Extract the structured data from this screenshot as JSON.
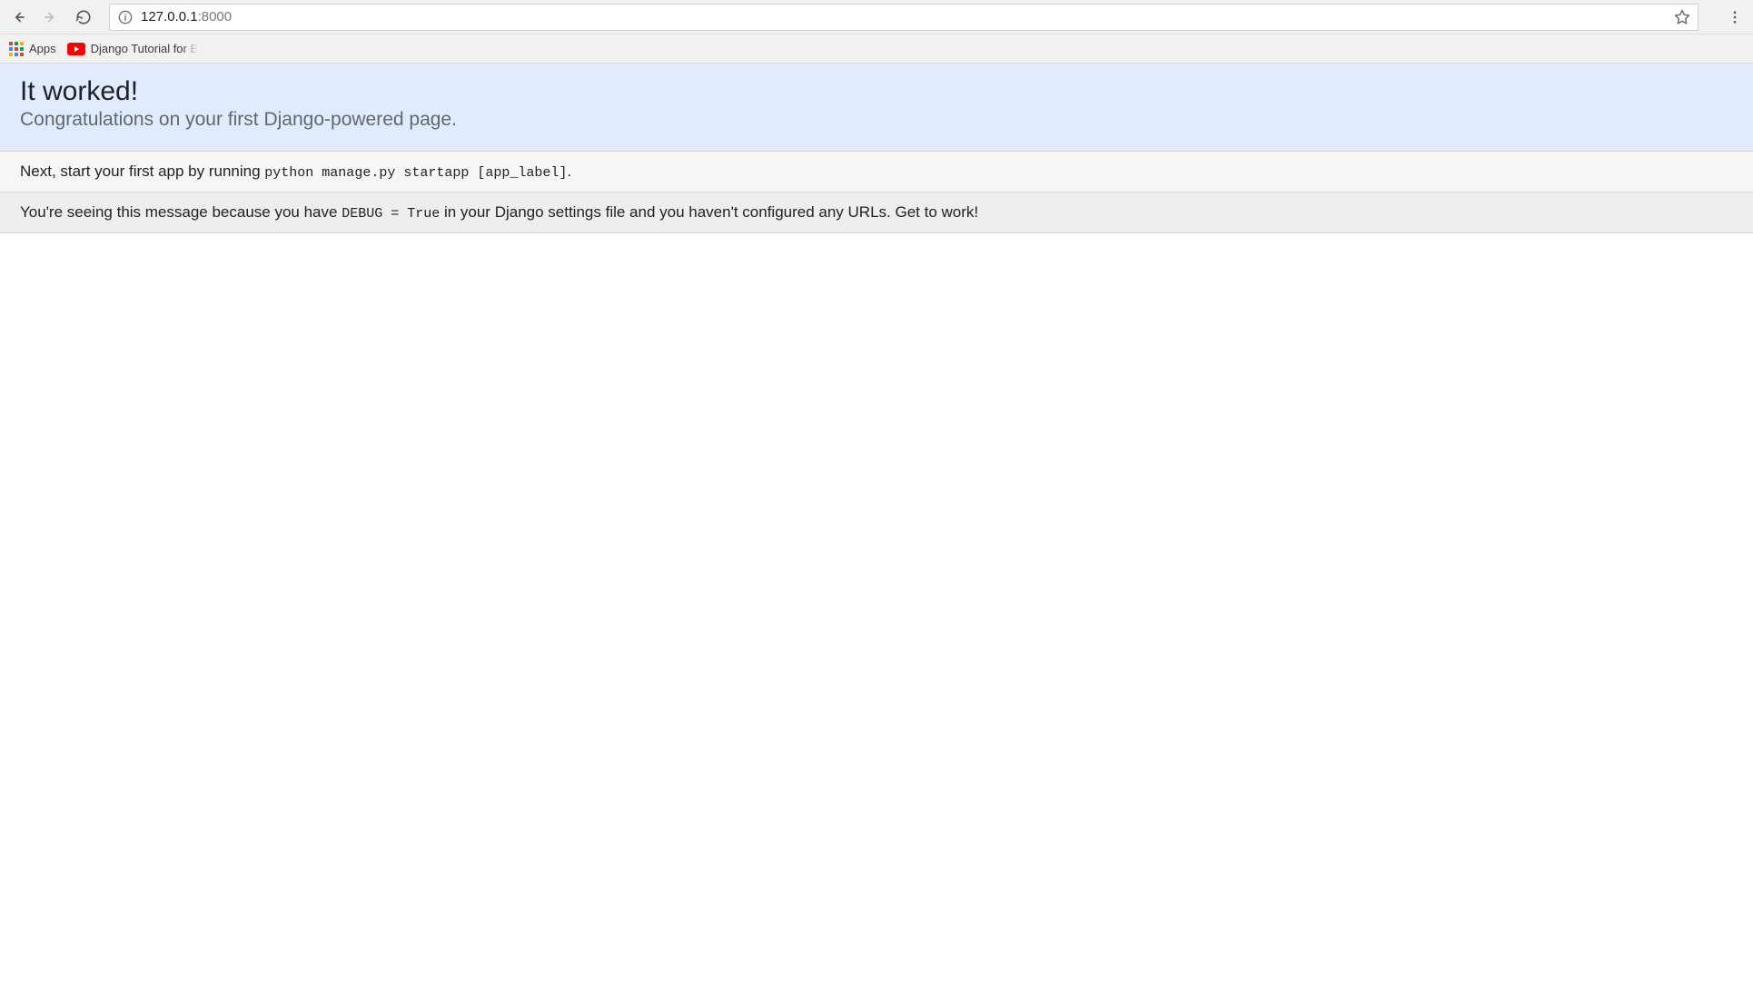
{
  "toolbar": {
    "url_host": "127.0.0.1",
    "url_port": ":8000"
  },
  "bookmarks": {
    "apps_label": "Apps",
    "items": [
      {
        "label": "Django Tutorial for B"
      }
    ]
  },
  "page": {
    "heading": "It worked!",
    "subtitle": "Congratulations on your first Django-powered page.",
    "instructions_prefix": "Next, start your first app by running ",
    "instructions_code": "python manage.py startapp [app_label]",
    "instructions_suffix": ".",
    "explanation_prefix": "You're seeing this message because you have ",
    "explanation_code": "DEBUG = True",
    "explanation_suffix": " in your Django settings file and you haven't configured any URLs. Get to work!"
  }
}
